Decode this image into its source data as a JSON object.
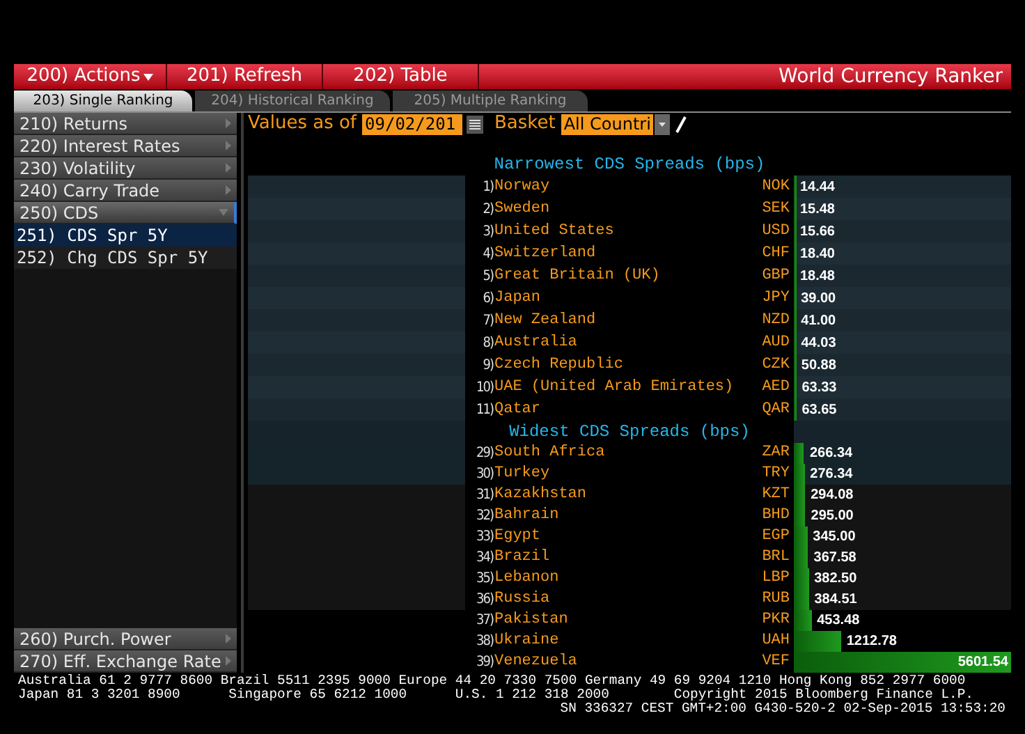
{
  "toolbar": {
    "buttons": [
      {
        "label": "200) Actions",
        "kind": "dropdown"
      },
      {
        "label": "201) Refresh",
        "kind": "button"
      },
      {
        "label": "202) Table",
        "kind": "button"
      }
    ],
    "title": "World Currency Ranker"
  },
  "tabs": [
    {
      "label": "203) Single Ranking",
      "selected": true
    },
    {
      "label": "204) Historical Ranking",
      "selected": false
    },
    {
      "label": "205) Multiple Ranking",
      "selected": false
    }
  ],
  "sidebar": {
    "items": [
      {
        "label": "210) Returns",
        "expanded": false
      },
      {
        "label": "220) Interest Rates",
        "expanded": false
      },
      {
        "label": "230) Volatility",
        "expanded": false
      },
      {
        "label": "240) Carry Trade",
        "expanded": false
      },
      {
        "label": "250) CDS",
        "expanded": true,
        "children": [
          {
            "label": "251) CDS Spr 5Y",
            "selected": true
          },
          {
            "label": "252) Chg CDS Spr 5Y",
            "selected": false
          }
        ]
      }
    ],
    "bottom_items": [
      {
        "label": "260) Purch. Power",
        "expanded": false
      },
      {
        "label": "270) Eff. Exchange Rate",
        "expanded": false
      }
    ]
  },
  "filters": {
    "date_label": "Values as of",
    "date_value": "09/02/201",
    "basket_label": "Basket",
    "basket_value": "All Countri"
  },
  "sections": [
    {
      "title": "Narrowest CDS Spreads (bps)",
      "rows": [
        {
          "rank": "1)",
          "country": "Norway",
          "currency": "NOK",
          "value": "14.44",
          "level": 0.003
        },
        {
          "rank": "2)",
          "country": "Sweden",
          "currency": "SEK",
          "value": "15.48",
          "level": 0.003
        },
        {
          "rank": "3)",
          "country": "United States",
          "currency": "USD",
          "value": "15.66",
          "level": 0.003
        },
        {
          "rank": "4)",
          "country": "Switzerland",
          "currency": "CHF",
          "value": "18.40",
          "level": 0.003
        },
        {
          "rank": "5)",
          "country": "Great Britain (UK)",
          "currency": "GBP",
          "value": "18.48",
          "level": 0.003
        },
        {
          "rank": "6)",
          "country": "Japan",
          "currency": "JPY",
          "value": "39.00",
          "level": 0.007
        },
        {
          "rank": "7)",
          "country": "New Zealand",
          "currency": "NZD",
          "value": "41.00",
          "level": 0.007
        },
        {
          "rank": "8)",
          "country": "Australia",
          "currency": "AUD",
          "value": "44.03",
          "level": 0.008
        },
        {
          "rank": "9)",
          "country": "Czech Republic",
          "currency": "CZK",
          "value": "50.88",
          "level": 0.009
        },
        {
          "rank": "10)",
          "country": "UAE (United Arab Emirates)",
          "currency": "AED",
          "value": "63.33",
          "level": 0.011
        },
        {
          "rank": "11)",
          "country": "Qatar",
          "currency": "QAR",
          "value": "63.65",
          "level": 0.011
        }
      ]
    },
    {
      "title": "Widest CDS Spreads (bps)",
      "rows": [
        {
          "rank": "29)",
          "country": "South Africa",
          "currency": "ZAR",
          "value": "266.34",
          "level": 0.048
        },
        {
          "rank": "30)",
          "country": "Turkey",
          "currency": "TRY",
          "value": "276.34",
          "level": 0.049
        },
        {
          "rank": "31)",
          "country": "Kazakhstan",
          "currency": "KZT",
          "value": "294.08",
          "level": 0.052
        },
        {
          "rank": "32)",
          "country": "Bahrain",
          "currency": "BHD",
          "value": "295.00",
          "level": 0.053
        },
        {
          "rank": "33)",
          "country": "Egypt",
          "currency": "EGP",
          "value": "345.00",
          "level": 0.062
        },
        {
          "rank": "34)",
          "country": "Brazil",
          "currency": "BRL",
          "value": "367.58",
          "level": 0.066
        },
        {
          "rank": "35)",
          "country": "Lebanon",
          "currency": "LBP",
          "value": "382.50",
          "level": 0.068
        },
        {
          "rank": "36)",
          "country": "Russia",
          "currency": "RUB",
          "value": "384.51",
          "level": 0.069
        },
        {
          "rank": "37)",
          "country": "Pakistan",
          "currency": "PKR",
          "value": "453.48",
          "level": 0.081
        },
        {
          "rank": "38)",
          "country": "Ukraine",
          "currency": "UAH",
          "value": "1212.78",
          "level": 0.217
        },
        {
          "rank": "39)",
          "country": "Venezuela",
          "currency": "VEF",
          "value": "5601.54",
          "level": 1
        }
      ]
    }
  ],
  "footer": [
    "Australia 61 2 9777 8600 Brazil 5511 2395 9000 Europe 44 20 7330 7500 Germany 49 69 9204 1210 Hong Kong 852 2977 6000",
    "Japan 81 3 3201 8900      Singapore 65 6212 1000      U.S. 1 212 318 2000        Copyright 2015 Bloomberg Finance L.P.",
    "SN 336327 CEST GMT+2:00 G430-520-2 02-Sep-2015 13:53:20"
  ]
}
